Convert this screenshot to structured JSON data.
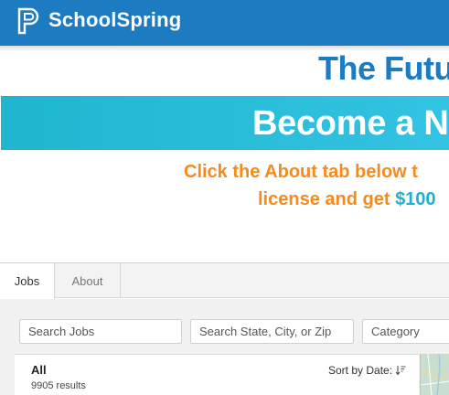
{
  "app": {
    "brand": "SchoolSpring"
  },
  "banner": {
    "headline": "The Futu",
    "band_text": "Become a N",
    "promo_line1": "Click the About tab below t",
    "promo_line2_prefix": "license and get ",
    "promo_line2_amount": "$100"
  },
  "tabs": [
    {
      "label": "Jobs",
      "active": true
    },
    {
      "label": "About",
      "active": false
    }
  ],
  "search": {
    "jobs_placeholder": "Search Jobs",
    "location_placeholder": "Search State, City, or Zip",
    "category_placeholder": "Category"
  },
  "results": {
    "heading": "All",
    "count": "9905 results",
    "sort_label": "Sort by Date:"
  },
  "colors": {
    "brand_blue": "#1d7bc1",
    "band_cyan": "#26bcd8",
    "promo_orange": "#f58a1f"
  }
}
